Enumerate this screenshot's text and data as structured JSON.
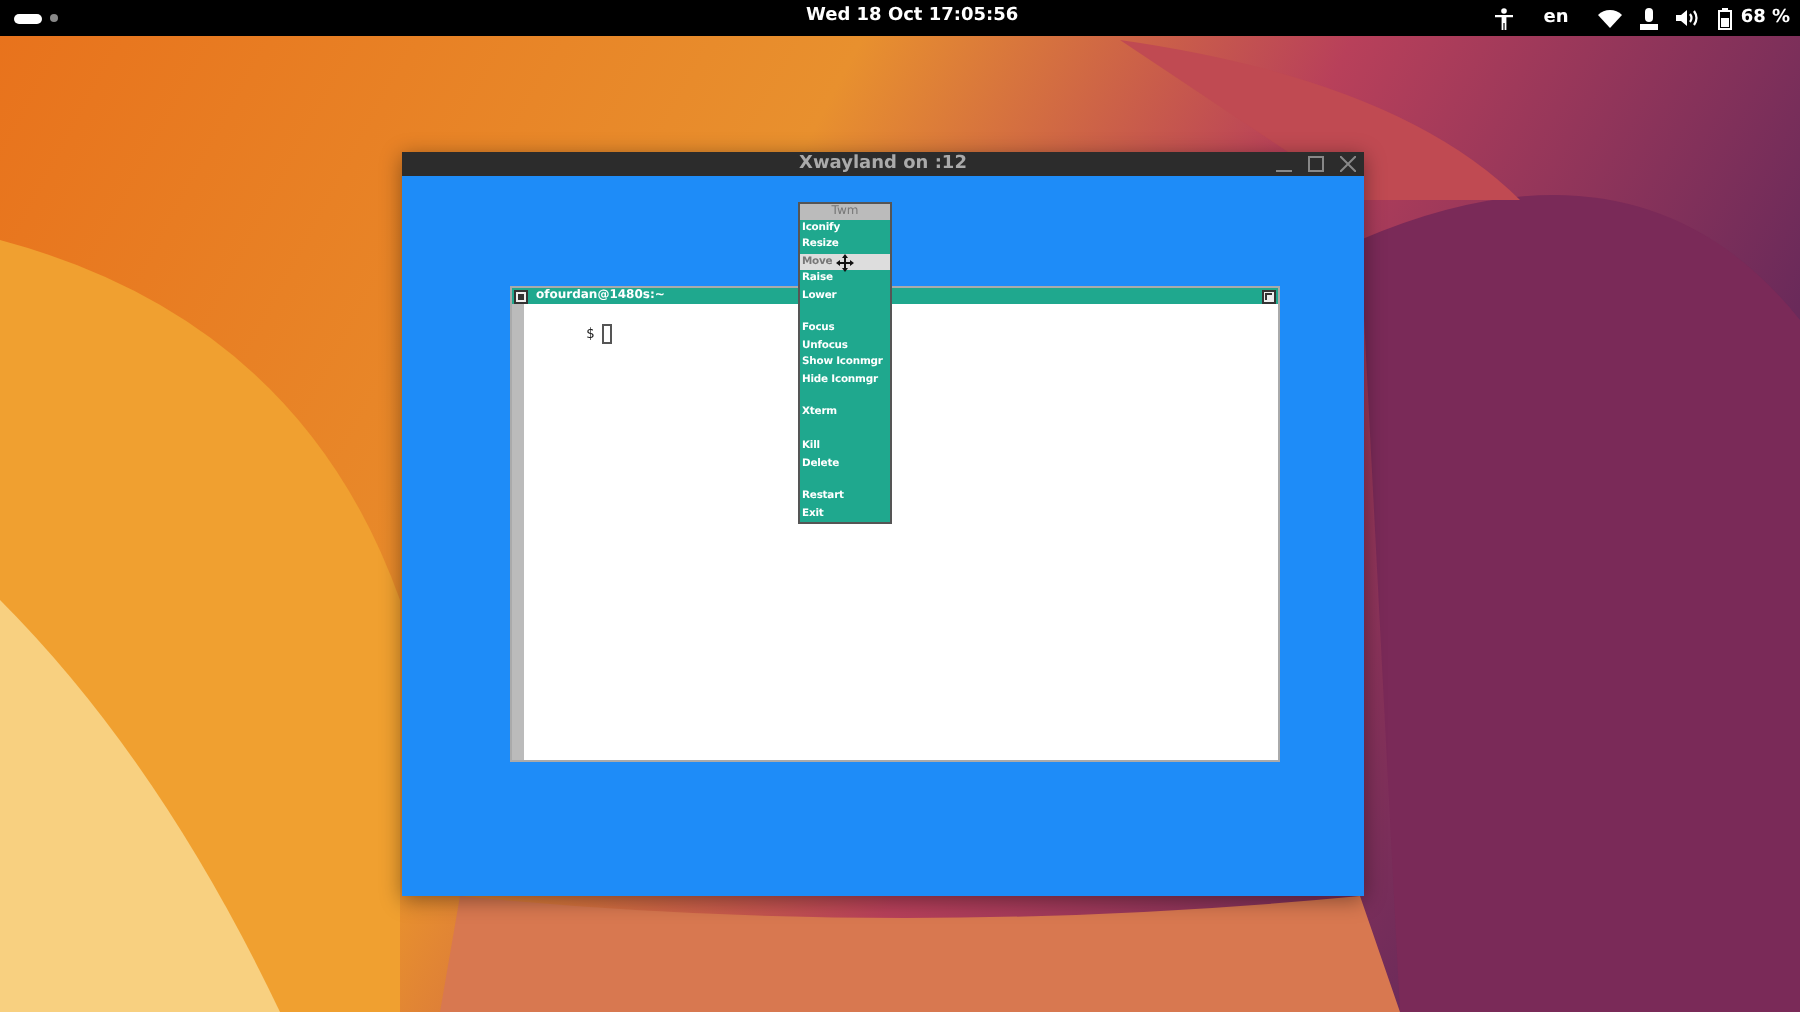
{
  "top_bar": {
    "clock": "Wed 18 Oct 17:05:56",
    "language": "en",
    "battery": "68 %"
  },
  "window": {
    "title": "Xwayland on :12"
  },
  "xterm": {
    "title": "ofourdan@1480s:~",
    "prompt": "$"
  },
  "menu": {
    "title": "Twm",
    "items": [
      {
        "kind": "item",
        "label": "Iconify",
        "selected": false
      },
      {
        "kind": "item",
        "label": "Resize",
        "selected": false
      },
      {
        "kind": "item",
        "label": "Move",
        "selected": true
      },
      {
        "kind": "item",
        "label": "Raise",
        "selected": false
      },
      {
        "kind": "item",
        "label": "Lower",
        "selected": false
      },
      {
        "kind": "blank"
      },
      {
        "kind": "item",
        "label": "Focus",
        "selected": false
      },
      {
        "kind": "item",
        "label": "Unfocus",
        "selected": false
      },
      {
        "kind": "item",
        "label": "Show Iconmgr",
        "selected": false
      },
      {
        "kind": "item",
        "label": "Hide Iconmgr",
        "selected": false
      },
      {
        "kind": "blank"
      },
      {
        "kind": "item",
        "label": "Xterm",
        "selected": false
      },
      {
        "kind": "blank"
      },
      {
        "kind": "item",
        "label": "Kill",
        "selected": false
      },
      {
        "kind": "item",
        "label": "Delete",
        "selected": false
      },
      {
        "kind": "blank"
      },
      {
        "kind": "item",
        "label": "Restart",
        "selected": false
      },
      {
        "kind": "item",
        "label": "Exit",
        "selected": false
      }
    ]
  }
}
